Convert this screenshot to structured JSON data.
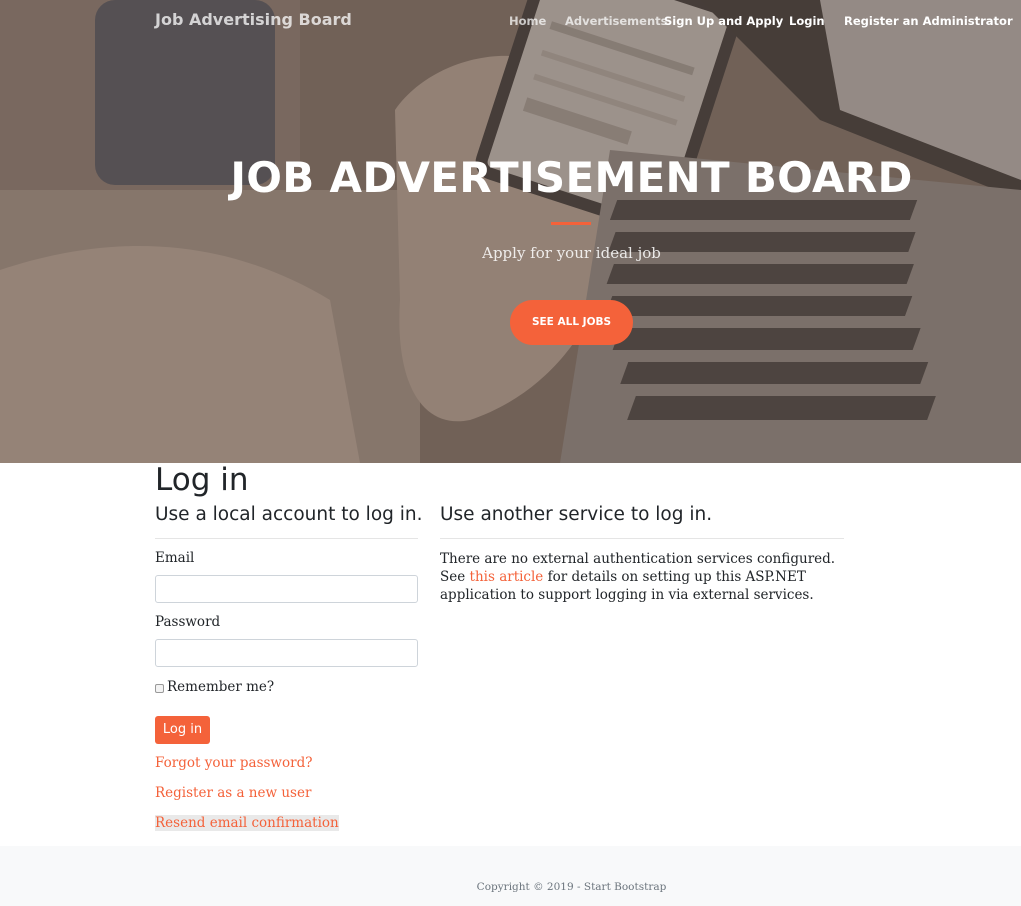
{
  "navbar": {
    "brand": "Job Advertising Board",
    "links": [
      {
        "label": "Home"
      },
      {
        "label": "Advertisements"
      },
      {
        "label": "Sign Up and Apply"
      },
      {
        "label": "Login"
      },
      {
        "label": "Register an Administrator"
      }
    ]
  },
  "hero": {
    "title": "JOB ADVERTISEMENT BOARD",
    "subtitle": "Apply for your ideal job",
    "cta_label": "SEE ALL JOBS"
  },
  "login": {
    "page_title": "Log in",
    "local_heading": "Use a local account to log in.",
    "email_label": "Email",
    "email_value": "",
    "password_label": "Password",
    "password_value": "",
    "remember_label": "Remember me?",
    "remember_checked": false,
    "submit_label": "Log in",
    "forgot_link": "Forgot your password?",
    "register_link": "Register as a new user",
    "resend_link": "Resend email confirmation"
  },
  "external": {
    "heading": "Use another service to log in.",
    "text_before": "There are no external authentication services configured. See ",
    "link_text": "this article",
    "text_after": " for details on setting up this ASP.NET application to support logging in via external services."
  },
  "footer": {
    "copyright": "Copyright © 2019 - Start Bootstrap"
  },
  "colors": {
    "accent": "#f4623a",
    "hero_overlay": "#5c4c44",
    "footer_bg": "#f8f9fa"
  }
}
